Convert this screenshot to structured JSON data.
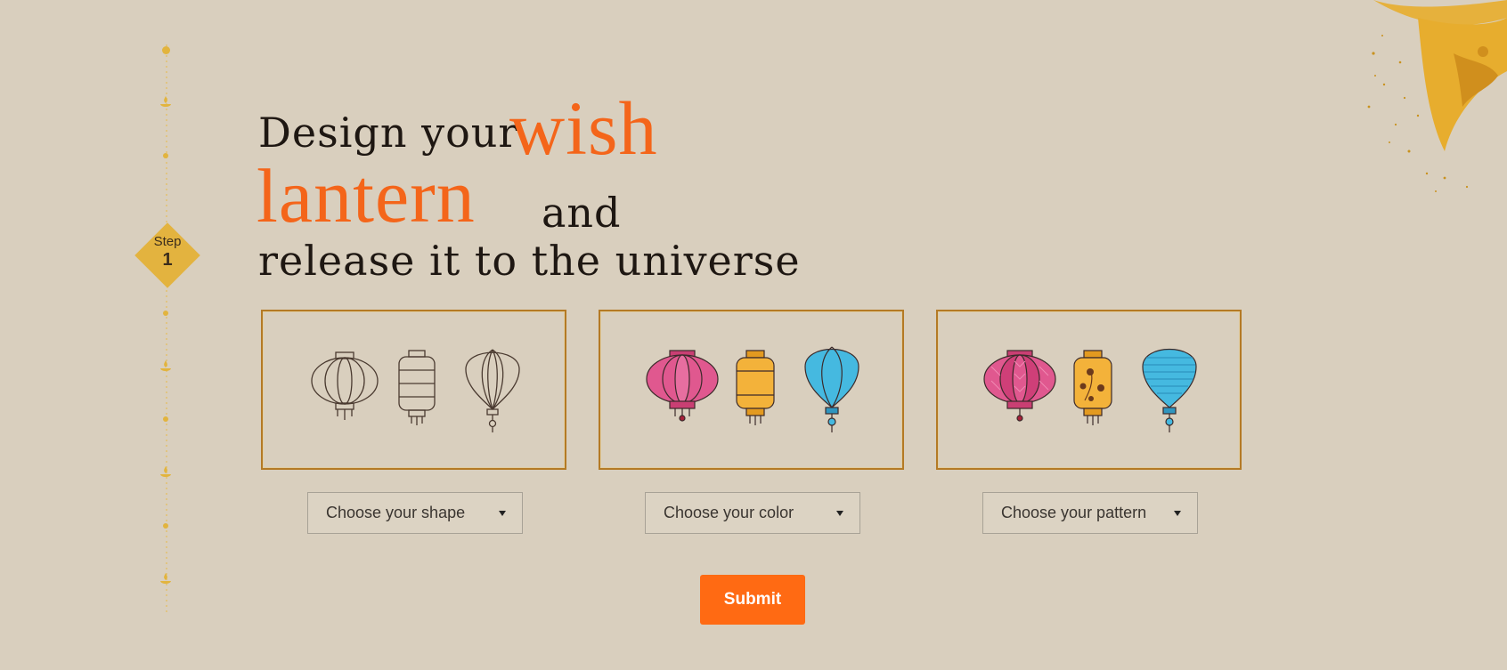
{
  "heading": {
    "line1_prefix": "Design your",
    "line1_accent": "wish",
    "line2_accent": "lantern",
    "line2_suffix": "and",
    "line3": "release it to the universe"
  },
  "step": {
    "label": "Step",
    "number": "1"
  },
  "options": [
    {
      "placeholder": "Choose your shape"
    },
    {
      "placeholder": "Choose your color"
    },
    {
      "placeholder": "Choose your pattern"
    }
  ],
  "submit_label": "Submit",
  "colors": {
    "background": "#d9cfbe",
    "accent": "#f4651a",
    "gold": "#e3b33f",
    "lantern_pink": "#e0588f",
    "lantern_yellow": "#f3b23a",
    "lantern_blue": "#45b9e0"
  },
  "icons": [
    "lantern-outline-icon",
    "lantern-colored-icon",
    "lantern-patterned-icon",
    "gold-leaf-ornament",
    "caret-down-icon"
  ]
}
